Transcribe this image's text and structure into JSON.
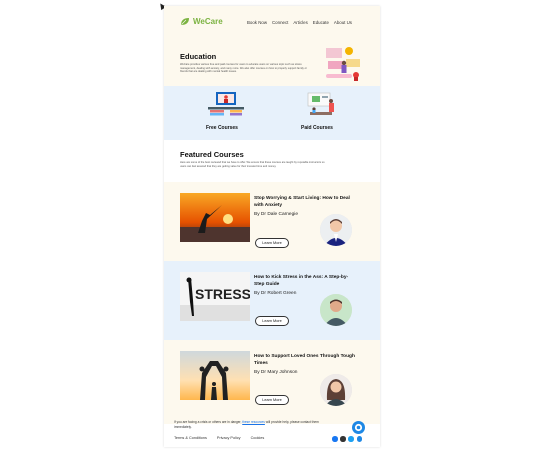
{
  "brand": {
    "name": "WeCare",
    "color": "#7cb342"
  },
  "nav": [
    {
      "label": "Book Now"
    },
    {
      "label": "Connect"
    },
    {
      "label": "Articles"
    },
    {
      "label": "Educate"
    },
    {
      "label": "About Us"
    }
  ],
  "education": {
    "title": "Education",
    "body": "WeCare provides various free and paid courses for users to educate users on various topic such as stress management, dealing with anxiety, and many more. We also offer courses on how to properly support family or friends that are dealing with mental health issues."
  },
  "courses": {
    "free_label": "Free Courses",
    "paid_label": "Paid Courses"
  },
  "featured": {
    "title": "Featured Courses",
    "body": "Here are some of the best reviewed that we have to offer. We ensure that these courses are taught by reputable instructors so users can feel assured that they are getting value for their invested time and money."
  },
  "cards": [
    {
      "title": "Stop Worrying & Start Living: How to Deal with Anxiety",
      "author": "By Dr Dale Carnegie",
      "button": "Learn More",
      "background": "#fdf9ee"
    },
    {
      "title": "How to Kick Stress in the Ass: A Step-by-Step Guide",
      "author": "By Dr Robert Green",
      "button": "Learn More",
      "background": "#e7f1fb"
    },
    {
      "title": "How to Support Loved Ones Through Tough Times",
      "author": "By Dr Mary Johnson",
      "button": "Learn More",
      "background": "#fdf9ee"
    }
  ],
  "footer": {
    "notice_before": "If you are facing a crisis or others are in danger,",
    "notice_link": "these resources",
    "notice_after": "will provide help, please contact them immediately.",
    "links": [
      {
        "label": "Terms & Conditions"
      },
      {
        "label": "Privacy Policy"
      },
      {
        "label": "Cookies"
      }
    ],
    "socials": [
      {
        "icon": "facebook-icon",
        "color": "#1877f2"
      },
      {
        "icon": "instagram-icon",
        "color": "#333333"
      },
      {
        "icon": "twitter-icon",
        "color": "#1da1f2"
      },
      {
        "icon": "email-icon",
        "color": "#1e88e5"
      }
    ],
    "chat_icon": "chat-icon"
  }
}
